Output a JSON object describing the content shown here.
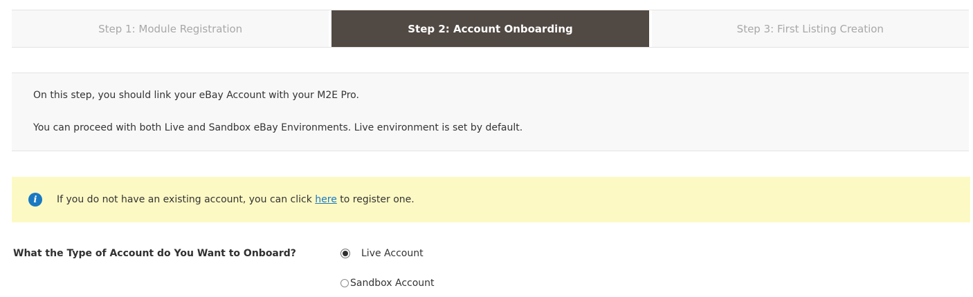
{
  "steps": [
    {
      "label": "Step 1: Module Registration",
      "state": "inactive"
    },
    {
      "label": "Step 2: Account Onboarding",
      "state": "active"
    },
    {
      "label": "Step 3: First Listing Creation",
      "state": "inactive"
    }
  ],
  "intro": {
    "line1": "On this step, you should link your eBay Account with your M2E Pro.",
    "line2": "You can proceed with both Live and Sandbox eBay Environments. Live environment is set by default."
  },
  "notice": {
    "icon": "info-icon",
    "text_before": "If you do not have an existing account, you can click ",
    "link_text": "here",
    "text_after": " to register one."
  },
  "account_type": {
    "question": "What the Type of Account do You Want to Onboard?",
    "options": [
      {
        "label": "Live Account",
        "checked": true
      },
      {
        "label": "Sandbox Account",
        "checked": false
      }
    ]
  },
  "colors": {
    "active_step_bg": "#514943",
    "notice_bg": "#fdf9c4",
    "link": "#1979c3"
  }
}
